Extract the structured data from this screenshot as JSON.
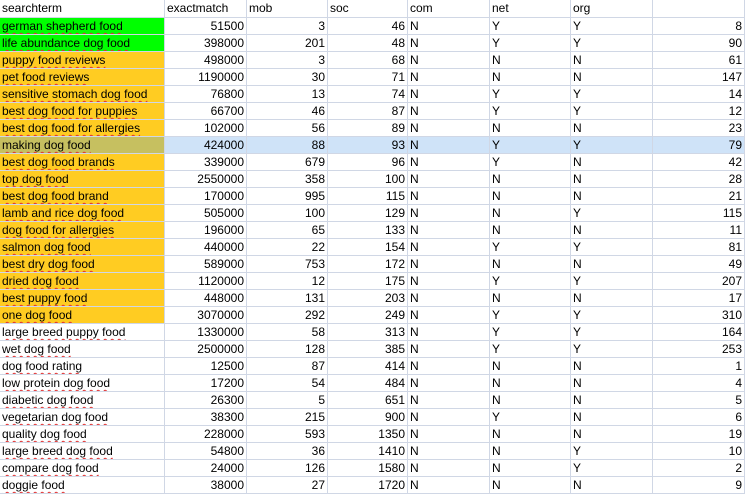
{
  "columns": [
    "searchterm",
    "exactmatch",
    "mob",
    "soc",
    "com",
    "net",
    "org",
    ""
  ],
  "rows": [
    {
      "term": "german shepherd food",
      "exact": "51500",
      "mob": "3",
      "soc": "46",
      "com": "N",
      "net": "Y",
      "org": "Y",
      "val": "8",
      "highlight": "green"
    },
    {
      "term": "life abundance dog food",
      "exact": "398000",
      "mob": "201",
      "soc": "48",
      "com": "N",
      "net": "Y",
      "org": "Y",
      "val": "90",
      "highlight": "green"
    },
    {
      "term": "puppy food reviews",
      "exact": "498000",
      "mob": "3",
      "soc": "68",
      "com": "N",
      "net": "N",
      "org": "N",
      "val": "61",
      "highlight": "yellow"
    },
    {
      "term": "pet food reviews",
      "exact": "1190000",
      "mob": "30",
      "soc": "71",
      "com": "N",
      "net": "N",
      "org": "N",
      "val": "147",
      "highlight": "yellow"
    },
    {
      "term": "sensitive stomach dog food",
      "exact": "76800",
      "mob": "13",
      "soc": "74",
      "com": "N",
      "net": "Y",
      "org": "Y",
      "val": "14",
      "highlight": "yellow"
    },
    {
      "term": "best dog food for puppies",
      "exact": "66700",
      "mob": "46",
      "soc": "87",
      "com": "N",
      "net": "Y",
      "org": "Y",
      "val": "12",
      "highlight": "yellow"
    },
    {
      "term": "best dog food for allergies",
      "exact": "102000",
      "mob": "56",
      "soc": "89",
      "com": "N",
      "net": "N",
      "org": "N",
      "val": "23",
      "highlight": "yellow"
    },
    {
      "term": "making dog food",
      "exact": "424000",
      "mob": "88",
      "soc": "93",
      "com": "N",
      "net": "Y",
      "org": "Y",
      "val": "79",
      "highlight": "selected"
    },
    {
      "term": "best dog food brands",
      "exact": "339000",
      "mob": "679",
      "soc": "96",
      "com": "N",
      "net": "Y",
      "org": "N",
      "val": "42",
      "highlight": "yellow"
    },
    {
      "term": "top dog food",
      "exact": "2550000",
      "mob": "358",
      "soc": "100",
      "com": "N",
      "net": "N",
      "org": "N",
      "val": "28",
      "highlight": "yellow"
    },
    {
      "term": "best dog food brand",
      "exact": "170000",
      "mob": "995",
      "soc": "115",
      "com": "N",
      "net": "N",
      "org": "N",
      "val": "21",
      "highlight": "yellow"
    },
    {
      "term": "lamb and rice dog food",
      "exact": "505000",
      "mob": "100",
      "soc": "129",
      "com": "N",
      "net": "N",
      "org": "Y",
      "val": "115",
      "highlight": "yellow"
    },
    {
      "term": "dog food for allergies",
      "exact": "196000",
      "mob": "65",
      "soc": "133",
      "com": "N",
      "net": "N",
      "org": "N",
      "val": "11",
      "highlight": "yellow"
    },
    {
      "term": "salmon dog food",
      "exact": "440000",
      "mob": "22",
      "soc": "154",
      "com": "N",
      "net": "Y",
      "org": "Y",
      "val": "81",
      "highlight": "yellow"
    },
    {
      "term": "best dry dog food",
      "exact": "589000",
      "mob": "753",
      "soc": "172",
      "com": "N",
      "net": "N",
      "org": "N",
      "val": "49",
      "highlight": "yellow"
    },
    {
      "term": "dried dog food",
      "exact": "1120000",
      "mob": "12",
      "soc": "175",
      "com": "N",
      "net": "Y",
      "org": "Y",
      "val": "207",
      "highlight": "yellow"
    },
    {
      "term": "best puppy food",
      "exact": "448000",
      "mob": "131",
      "soc": "203",
      "com": "N",
      "net": "N",
      "org": "N",
      "val": "17",
      "highlight": "yellow"
    },
    {
      "term": "one dog food",
      "exact": "3070000",
      "mob": "292",
      "soc": "249",
      "com": "N",
      "net": "Y",
      "org": "Y",
      "val": "310",
      "highlight": "yellow"
    },
    {
      "term": "large breed puppy food",
      "exact": "1330000",
      "mob": "58",
      "soc": "313",
      "com": "N",
      "net": "Y",
      "org": "Y",
      "val": "164",
      "highlight": "none"
    },
    {
      "term": "wet dog food",
      "exact": "2500000",
      "mob": "128",
      "soc": "385",
      "com": "N",
      "net": "Y",
      "org": "Y",
      "val": "253",
      "highlight": "none"
    },
    {
      "term": "dog food rating",
      "exact": "12500",
      "mob": "87",
      "soc": "414",
      "com": "N",
      "net": "N",
      "org": "N",
      "val": "1",
      "highlight": "none"
    },
    {
      "term": "low protein dog food",
      "exact": "17200",
      "mob": "54",
      "soc": "484",
      "com": "N",
      "net": "N",
      "org": "N",
      "val": "4",
      "highlight": "none"
    },
    {
      "term": "diabetic dog food",
      "exact": "26300",
      "mob": "5",
      "soc": "651",
      "com": "N",
      "net": "N",
      "org": "N",
      "val": "5",
      "highlight": "none"
    },
    {
      "term": "vegetarian dog food",
      "exact": "38300",
      "mob": "215",
      "soc": "900",
      "com": "N",
      "net": "Y",
      "org": "N",
      "val": "6",
      "highlight": "none"
    },
    {
      "term": "quality dog food",
      "exact": "228000",
      "mob": "593",
      "soc": "1350",
      "com": "N",
      "net": "N",
      "org": "N",
      "val": "19",
      "highlight": "none"
    },
    {
      "term": "large breed dog food",
      "exact": "54800",
      "mob": "36",
      "soc": "1410",
      "com": "N",
      "net": "N",
      "org": "Y",
      "val": "10",
      "highlight": "none"
    },
    {
      "term": "compare dog food",
      "exact": "24000",
      "mob": "126",
      "soc": "1580",
      "com": "N",
      "net": "N",
      "org": "Y",
      "val": "2",
      "highlight": "none"
    },
    {
      "term": "doggie food",
      "exact": "38000",
      "mob": "27",
      "soc": "1720",
      "com": "N",
      "net": "N",
      "org": "N",
      "val": "9",
      "highlight": "none"
    }
  ],
  "colors": {
    "green": "#00ff00",
    "yellow": "#ffcc22",
    "olive": "#c6c060",
    "selection": "#cfe3f8",
    "gridline": "#d0d7e5",
    "spellcheck": "#e03030"
  }
}
